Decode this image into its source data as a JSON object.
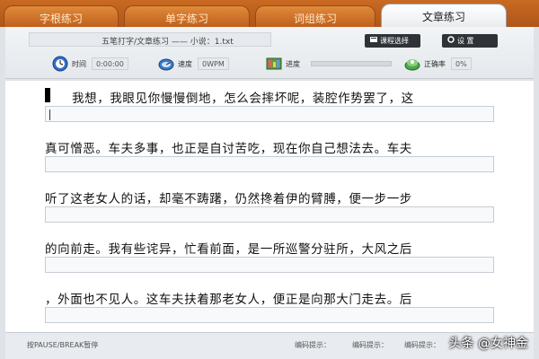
{
  "tabs": [
    {
      "label": "字根练习"
    },
    {
      "label": "单字练习"
    },
    {
      "label": "词组练习"
    },
    {
      "label": "文章练习"
    }
  ],
  "active_tab": "文章练习",
  "file_info": "五笔打字/文章练习 —— 小说：1.txt",
  "buttons": {
    "choose_course": "课程选择",
    "settings": "设 置"
  },
  "stats": {
    "time_label": "时间",
    "time_value": "0:00:00",
    "speed_label": "速度",
    "speed_value": "0WPM",
    "progress_label": "进度",
    "progress_value": 0,
    "accuracy_label": "正确率",
    "accuracy_value": "0%"
  },
  "lines": [
    {
      "text": "我想，我眼见你慢慢倒地，怎么会摔坏呢，装腔作势罢了，这"
    },
    {
      "text": "真可憎恶。车夫多事，也正是自讨苦吃，现在你自己想法去。车夫"
    },
    {
      "text": "听了这老女人的话，却毫不踌躇，仍然搀着伊的臂膊，便一步一步"
    },
    {
      "text": "的向前走。我有些诧异，忙看前面，是一所巡警分驻所，大风之后"
    },
    {
      "text": "，外面也不见人。这车夫扶着那老女人，便正是向那大门走去。后"
    }
  ],
  "bottom": {
    "pause_hint": "按PAUSE/BREAK暂停",
    "code_hint_1": "编码提示：",
    "code_hint_2": "编码提示：",
    "code_hint_3": "编码提示："
  },
  "watermark": "头条 @女神金",
  "colors": {
    "tab_bar": "#b0551a",
    "active_tab": "#ffffff",
    "accent_green": "#7cb36a"
  }
}
